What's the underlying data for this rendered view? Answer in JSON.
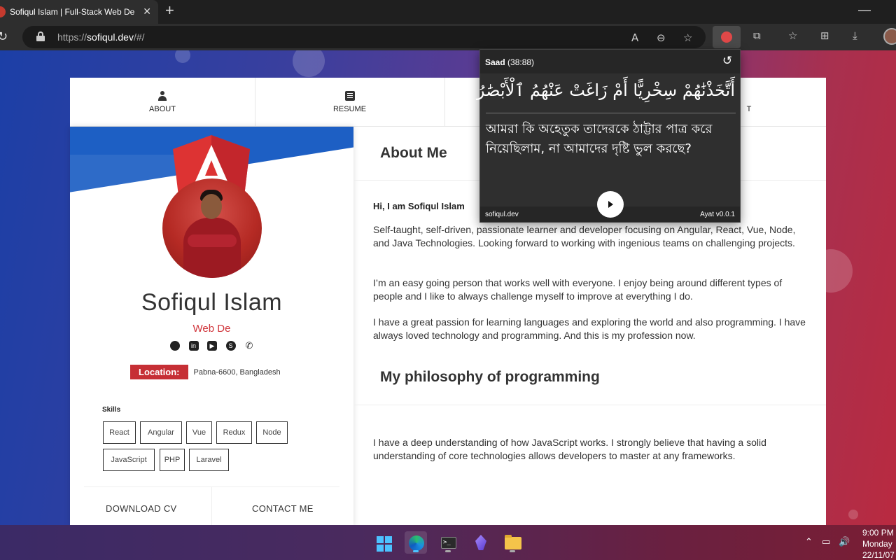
{
  "browser": {
    "tab_title": "Sofiqul Islam | Full-Stack Web De",
    "tab_close": "✕",
    "new_tab": "+",
    "minimize": "—",
    "url_scheme": "https://",
    "url_host": "sofiqul.dev",
    "url_path": "/#/"
  },
  "nav": {
    "about": "ABOUT",
    "resume": "RESUME",
    "contact_tail": "T"
  },
  "profile": {
    "name": "Sofiqul Islam",
    "role": "Web De",
    "location_label": "Location:",
    "location_value": "Pabna-6600, Bangladesh",
    "skills_title": "Skills",
    "skills": [
      "React",
      "Angular",
      "Vue",
      "Redux",
      "Node",
      "JavaScript",
      "PHP",
      "Laravel"
    ],
    "download_cv": "DOWNLOAD CV",
    "contact_me": "CONTACT ME"
  },
  "about": {
    "heading": "About Me",
    "greeting": "Hi, I am Sofiqul Islam",
    "p1": "Self-taught, self-driven, passionate learner and developer focusing on Angular, React, Vue, Node, and Java Technologies. Looking forward to working with ingenious teams on challenging projects.",
    "p2": "I’m an easy going person that works well with everyone. I enjoy being around different types of people and I like to always challenge myself to improve at everything I do.",
    "p3": "I have a great passion for learning languages and exploring the world and also programming. I have always loved technology and programming. And this is my profession now.",
    "philosophy_heading": "My philosophy of programming",
    "p4": "I have a deep understanding of how JavaScript works. I strongly believe that having a solid understanding of core technologies allows developers to master at any frameworks."
  },
  "popup": {
    "surah": "Saad",
    "ref": "(38:88)",
    "arabic": "أَتَّخَذْنَٰهُمْ سِخْرِيًّا أَمْ زَاغَتْ عَنْهُمُ ٱلْأَبْصَٰرُ",
    "translation": "আমরা কি অহেতুক তাদেরকে ঠাট্টার পাত্র করে নিয়েছিলাম, না আমাদের দৃষ্টি ভুল করছে?",
    "footer_left": "sofiqul.dev",
    "footer_right": "Ayat v0.0.1"
  },
  "taskbar": {
    "time": "9:00 PM",
    "day": "Monday",
    "date": "22/11/07"
  },
  "colors": {
    "accent_red": "#c62f35",
    "banner_blue": "#1d5fc4",
    "windows_blue": "#4cc2ff"
  }
}
